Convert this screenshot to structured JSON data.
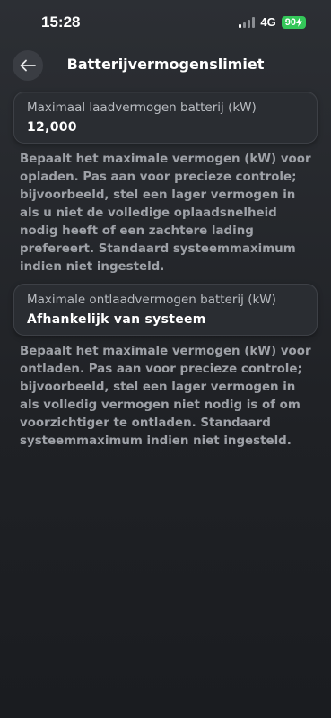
{
  "status_bar": {
    "time": "15:28",
    "network": "4G",
    "battery": "90",
    "battery_color": "#34c759"
  },
  "header": {
    "back_icon": "arrow-left-icon",
    "title": "Batterijvermogenslimiet"
  },
  "charge_limit": {
    "label": "Maximaal laadvermogen batterij (kW)",
    "value": "12,000",
    "description": "Bepaalt het maximale vermogen (kW) voor opladen. Pas aan voor precieze controle; bijvoorbeeld, stel een lager vermogen in als u niet de volledige oplaadsnelheid nodig heeft of een zachtere lading prefereert. Standaard systeemmaximum indien niet ingesteld."
  },
  "discharge_limit": {
    "label": "Maximale ontlaadvermogen batterij (kW)",
    "value": "Afhankelijk van systeem",
    "description": "Bepaalt het maximale vermogen (kW) voor ontladen. Pas aan voor precieze controle; bijvoorbeeld, stel een lager vermogen in als volledig vermogen niet nodig is of om voorzichtiger te ontladen. Standaard systeemmaximum indien niet ingesteld."
  }
}
